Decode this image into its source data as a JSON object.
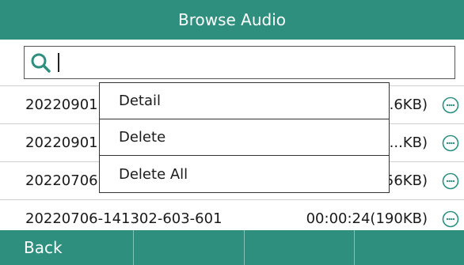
{
  "title": "Browse Audio",
  "search": {
    "value": "",
    "placeholder": ""
  },
  "files": [
    {
      "name": "20220901",
      "info": "(...6KB)"
    },
    {
      "name": "20220901",
      "info": "(...KB)"
    },
    {
      "name": "20220706",
      "info": "(...56KB)"
    },
    {
      "name": "20220706-141302-603-601",
      "info": "00:00:24(190KB)"
    }
  ],
  "context_menu": [
    "Detail",
    "Delete",
    "Delete All"
  ],
  "softkeys": [
    "Back",
    "",
    "",
    ""
  ],
  "colors": {
    "accent": "#2e8f7f"
  }
}
